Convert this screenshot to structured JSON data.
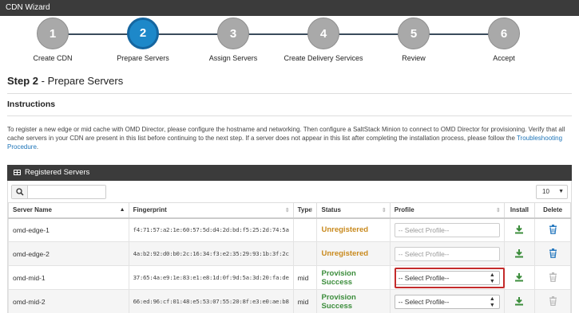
{
  "window": {
    "title": "CDN Wizard"
  },
  "wizard": {
    "steps": [
      {
        "number": "1",
        "label": "Create CDN"
      },
      {
        "number": "2",
        "label": "Prepare Servers"
      },
      {
        "number": "3",
        "label": "Assign Servers"
      },
      {
        "number": "4",
        "label": "Create Delivery Services"
      },
      {
        "number": "5",
        "label": "Review"
      },
      {
        "number": "6",
        "label": "Accept"
      }
    ],
    "active_step": 2
  },
  "page": {
    "step_prefix": "Step 2",
    "step_title": " - Prepare Servers",
    "instructions_heading": "Instructions",
    "instructions_text": "To register a new edge or mid cache with OMD Director, please configure the hostname and networking. Then configure a SaltStack Minion to connect to OMD Director for provisioning. Verify that all cache servers in your CDN are present in this list before continuing to the next step. If a server does not appear in this list after completing the installation process, please follow the ",
    "instructions_link": "Troubleshooting Procedure",
    "instructions_end": "."
  },
  "panel": {
    "title": "Registered Servers",
    "search": {
      "value": "",
      "placeholder": ""
    },
    "page_size": "10"
  },
  "table": {
    "columns": [
      "Server Name",
      "Fingerprint",
      "Type",
      "Status",
      "Profile",
      "Install",
      "Delete"
    ],
    "rows": [
      {
        "name": "omd-edge-1",
        "fingerprint": "f4:71:57:a2:1e:60:57:5d:d4:2d:bd:f5:25:2d:74:5a",
        "type": "",
        "status": "Unregistered",
        "profile": "-- Select Profile--"
      },
      {
        "name": "omd-edge-2",
        "fingerprint": "4a:b2:92:d0:b0:2c:16:34:f3:e2:35:29:93:1b:3f:2c",
        "type": "",
        "status": "Unregistered",
        "profile": "-- Select Profile--"
      },
      {
        "name": "omd-mid-1",
        "fingerprint": "37:65:4a:e9:1e:83:e1:e8:1d:0f:9d:5a:3d:20:fa:de",
        "type": "mid",
        "status": "Provision Success",
        "profile": "-- Select Profile--"
      },
      {
        "name": "omd-mid-2",
        "fingerprint": "66:ed:96:cf:01:48:e5:53:07:55:20:8f:e3:e0:ae:b8",
        "type": "mid",
        "status": "Provision Success",
        "profile": "-- Select Profile--"
      }
    ]
  },
  "colors": {
    "accent": "#1d88c9",
    "unregistered": "#c98a1e",
    "success": "#3c8d3c",
    "highlight": "#c42b2b"
  },
  "icons": {
    "install": "download-icon",
    "delete": "trash-icon",
    "search": "search-icon",
    "grid": "grid-icon"
  }
}
